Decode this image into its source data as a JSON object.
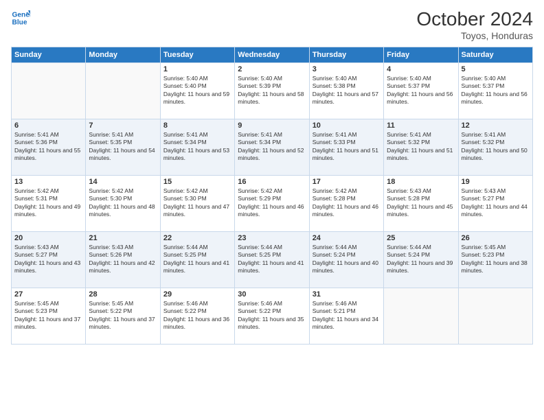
{
  "logo": {
    "line1": "General",
    "line2": "Blue"
  },
  "header": {
    "month": "October 2024",
    "location": "Toyos, Honduras"
  },
  "weekdays": [
    "Sunday",
    "Monday",
    "Tuesday",
    "Wednesday",
    "Thursday",
    "Friday",
    "Saturday"
  ],
  "weeks": [
    [
      {
        "day": "",
        "sunrise": "",
        "sunset": "",
        "daylight": ""
      },
      {
        "day": "",
        "sunrise": "",
        "sunset": "",
        "daylight": ""
      },
      {
        "day": "1",
        "sunrise": "Sunrise: 5:40 AM",
        "sunset": "Sunset: 5:40 PM",
        "daylight": "Daylight: 11 hours and 59 minutes."
      },
      {
        "day": "2",
        "sunrise": "Sunrise: 5:40 AM",
        "sunset": "Sunset: 5:39 PM",
        "daylight": "Daylight: 11 hours and 58 minutes."
      },
      {
        "day": "3",
        "sunrise": "Sunrise: 5:40 AM",
        "sunset": "Sunset: 5:38 PM",
        "daylight": "Daylight: 11 hours and 57 minutes."
      },
      {
        "day": "4",
        "sunrise": "Sunrise: 5:40 AM",
        "sunset": "Sunset: 5:37 PM",
        "daylight": "Daylight: 11 hours and 56 minutes."
      },
      {
        "day": "5",
        "sunrise": "Sunrise: 5:40 AM",
        "sunset": "Sunset: 5:37 PM",
        "daylight": "Daylight: 11 hours and 56 minutes."
      }
    ],
    [
      {
        "day": "6",
        "sunrise": "Sunrise: 5:41 AM",
        "sunset": "Sunset: 5:36 PM",
        "daylight": "Daylight: 11 hours and 55 minutes."
      },
      {
        "day": "7",
        "sunrise": "Sunrise: 5:41 AM",
        "sunset": "Sunset: 5:35 PM",
        "daylight": "Daylight: 11 hours and 54 minutes."
      },
      {
        "day": "8",
        "sunrise": "Sunrise: 5:41 AM",
        "sunset": "Sunset: 5:34 PM",
        "daylight": "Daylight: 11 hours and 53 minutes."
      },
      {
        "day": "9",
        "sunrise": "Sunrise: 5:41 AM",
        "sunset": "Sunset: 5:34 PM",
        "daylight": "Daylight: 11 hours and 52 minutes."
      },
      {
        "day": "10",
        "sunrise": "Sunrise: 5:41 AM",
        "sunset": "Sunset: 5:33 PM",
        "daylight": "Daylight: 11 hours and 51 minutes."
      },
      {
        "day": "11",
        "sunrise": "Sunrise: 5:41 AM",
        "sunset": "Sunset: 5:32 PM",
        "daylight": "Daylight: 11 hours and 51 minutes."
      },
      {
        "day": "12",
        "sunrise": "Sunrise: 5:41 AM",
        "sunset": "Sunset: 5:32 PM",
        "daylight": "Daylight: 11 hours and 50 minutes."
      }
    ],
    [
      {
        "day": "13",
        "sunrise": "Sunrise: 5:42 AM",
        "sunset": "Sunset: 5:31 PM",
        "daylight": "Daylight: 11 hours and 49 minutes."
      },
      {
        "day": "14",
        "sunrise": "Sunrise: 5:42 AM",
        "sunset": "Sunset: 5:30 PM",
        "daylight": "Daylight: 11 hours and 48 minutes."
      },
      {
        "day": "15",
        "sunrise": "Sunrise: 5:42 AM",
        "sunset": "Sunset: 5:30 PM",
        "daylight": "Daylight: 11 hours and 47 minutes."
      },
      {
        "day": "16",
        "sunrise": "Sunrise: 5:42 AM",
        "sunset": "Sunset: 5:29 PM",
        "daylight": "Daylight: 11 hours and 46 minutes."
      },
      {
        "day": "17",
        "sunrise": "Sunrise: 5:42 AM",
        "sunset": "Sunset: 5:28 PM",
        "daylight": "Daylight: 11 hours and 46 minutes."
      },
      {
        "day": "18",
        "sunrise": "Sunrise: 5:43 AM",
        "sunset": "Sunset: 5:28 PM",
        "daylight": "Daylight: 11 hours and 45 minutes."
      },
      {
        "day": "19",
        "sunrise": "Sunrise: 5:43 AM",
        "sunset": "Sunset: 5:27 PM",
        "daylight": "Daylight: 11 hours and 44 minutes."
      }
    ],
    [
      {
        "day": "20",
        "sunrise": "Sunrise: 5:43 AM",
        "sunset": "Sunset: 5:27 PM",
        "daylight": "Daylight: 11 hours and 43 minutes."
      },
      {
        "day": "21",
        "sunrise": "Sunrise: 5:43 AM",
        "sunset": "Sunset: 5:26 PM",
        "daylight": "Daylight: 11 hours and 42 minutes."
      },
      {
        "day": "22",
        "sunrise": "Sunrise: 5:44 AM",
        "sunset": "Sunset: 5:25 PM",
        "daylight": "Daylight: 11 hours and 41 minutes."
      },
      {
        "day": "23",
        "sunrise": "Sunrise: 5:44 AM",
        "sunset": "Sunset: 5:25 PM",
        "daylight": "Daylight: 11 hours and 41 minutes."
      },
      {
        "day": "24",
        "sunrise": "Sunrise: 5:44 AM",
        "sunset": "Sunset: 5:24 PM",
        "daylight": "Daylight: 11 hours and 40 minutes."
      },
      {
        "day": "25",
        "sunrise": "Sunrise: 5:44 AM",
        "sunset": "Sunset: 5:24 PM",
        "daylight": "Daylight: 11 hours and 39 minutes."
      },
      {
        "day": "26",
        "sunrise": "Sunrise: 5:45 AM",
        "sunset": "Sunset: 5:23 PM",
        "daylight": "Daylight: 11 hours and 38 minutes."
      }
    ],
    [
      {
        "day": "27",
        "sunrise": "Sunrise: 5:45 AM",
        "sunset": "Sunset: 5:23 PM",
        "daylight": "Daylight: 11 hours and 37 minutes."
      },
      {
        "day": "28",
        "sunrise": "Sunrise: 5:45 AM",
        "sunset": "Sunset: 5:22 PM",
        "daylight": "Daylight: 11 hours and 37 minutes."
      },
      {
        "day": "29",
        "sunrise": "Sunrise: 5:46 AM",
        "sunset": "Sunset: 5:22 PM",
        "daylight": "Daylight: 11 hours and 36 minutes."
      },
      {
        "day": "30",
        "sunrise": "Sunrise: 5:46 AM",
        "sunset": "Sunset: 5:22 PM",
        "daylight": "Daylight: 11 hours and 35 minutes."
      },
      {
        "day": "31",
        "sunrise": "Sunrise: 5:46 AM",
        "sunset": "Sunset: 5:21 PM",
        "daylight": "Daylight: 11 hours and 34 minutes."
      },
      {
        "day": "",
        "sunrise": "",
        "sunset": "",
        "daylight": ""
      },
      {
        "day": "",
        "sunrise": "",
        "sunset": "",
        "daylight": ""
      }
    ]
  ]
}
